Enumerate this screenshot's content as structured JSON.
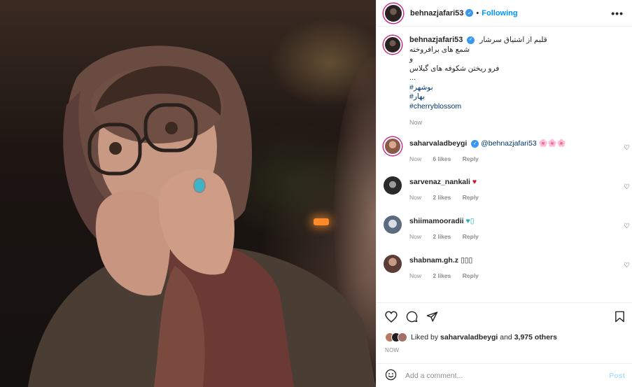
{
  "post": {
    "username": "behnazjafari53",
    "follow_status": "Following",
    "separator": "•"
  },
  "caption": {
    "username": "behnazjafari53",
    "lines": [
      "قلبم از اشتیاق سرشار",
      "شمع های برافروخته",
      "و",
      "فرو ریختن شکوفه های گیلاس",
      "..."
    ],
    "hashtags": [
      "#بوشهر",
      "#بهار",
      "#cherryblossom"
    ],
    "time": "Now"
  },
  "comments": [
    {
      "username": "saharvaladbeygi",
      "verified": true,
      "mention": "@behnazjafari53",
      "text": "🌸🌸🌸",
      "time": "Now",
      "likes": "6 likes",
      "reply": "Reply",
      "avatar_color": "#b57a63"
    },
    {
      "username": "sarvenaz_nankali",
      "verified": false,
      "mention": "",
      "text": "♥",
      "time": "Now",
      "likes": "2 likes",
      "reply": "Reply",
      "avatar_color": "#3b3b3b"
    },
    {
      "username": "shiimamooradii",
      "verified": false,
      "mention": "",
      "text": "♥▯",
      "time": "Now",
      "likes": "2 likes",
      "reply": "Reply",
      "avatar_color": "#7a8aa0"
    },
    {
      "username": "shabnam.gh.z",
      "verified": false,
      "mention": "",
      "text": "▯▯▯",
      "time": "Now",
      "likes": "2 likes",
      "reply": "Reply",
      "avatar_color": "#6b4a44"
    }
  ],
  "likes": {
    "prefix": "Liked by",
    "user": "saharvaladbeygi",
    "connector": "and",
    "others": "3,975 others"
  },
  "date": "NOW",
  "add_comment": {
    "placeholder": "Add a comment...",
    "post_label": "Post"
  },
  "colors": {
    "accent": "#0095f6",
    "verified": "#3897f0",
    "story_ring": "#c72a86",
    "heart_red": "#c0142c",
    "heart_teal": "#2bb3b3"
  }
}
